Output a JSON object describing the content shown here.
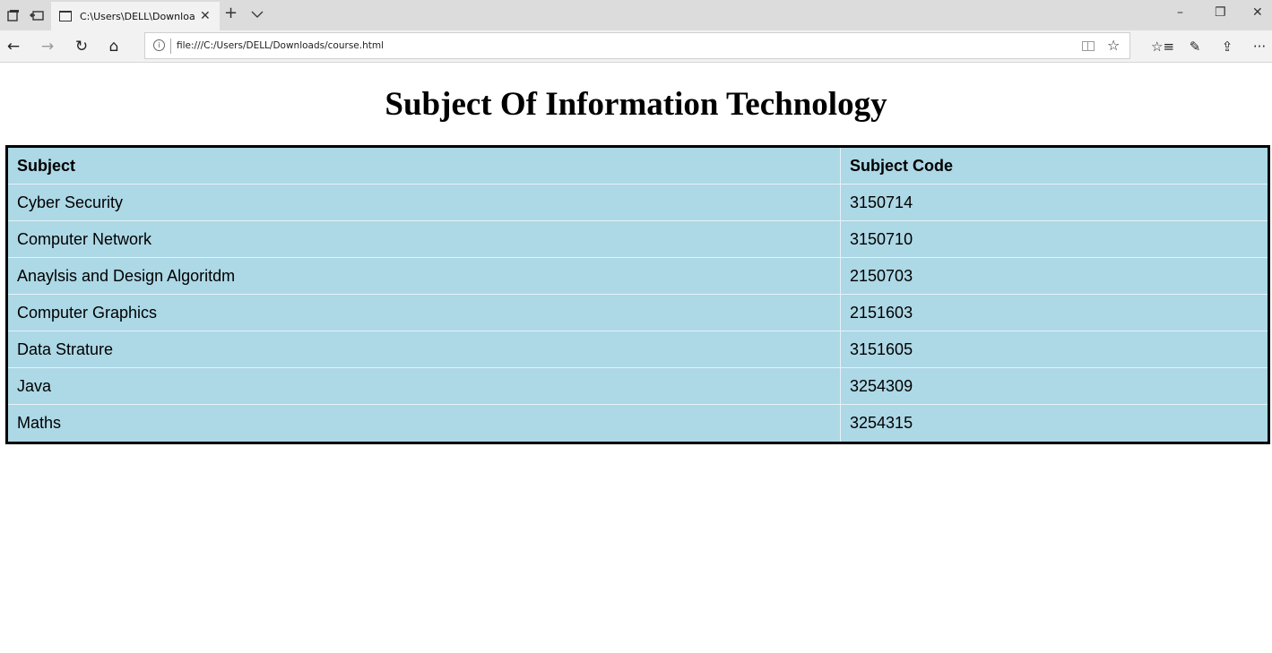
{
  "browser": {
    "tab_title": "C:\\Users\\DELL\\Downloa",
    "tab_close": "✕",
    "new_tab": "+",
    "tab_list": "⌵",
    "address_url": "file:///C:/Users/DELL/Downloads/course.html",
    "info_glyph": "i",
    "window_controls": {
      "minimize": "–",
      "restore": "❐",
      "close": "✕"
    },
    "nav": {
      "back": "←",
      "forward": "→",
      "refresh": "↻",
      "home": "⌂"
    },
    "toolbar": {
      "favorites_bar": "☆≡",
      "notes": "✎",
      "share": "⇪",
      "more": "···"
    },
    "star": "☆"
  },
  "page": {
    "title": "Subject Of Information Technology",
    "table": {
      "headers": [
        "Subject",
        "Subject Code"
      ],
      "rows": [
        [
          "Cyber Security",
          "3150714"
        ],
        [
          "Computer Network",
          "3150710"
        ],
        [
          "Anaylsis and Design Algoritdm",
          "2150703"
        ],
        [
          "Computer Graphics",
          "2151603"
        ],
        [
          "Data Strature",
          "3151605"
        ],
        [
          "Java",
          "3254309"
        ],
        [
          "Maths",
          "3254315"
        ]
      ],
      "background_color": "#add8e6",
      "border_color": "#000000"
    }
  }
}
